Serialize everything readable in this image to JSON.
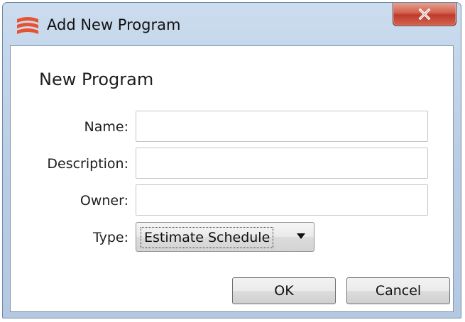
{
  "window": {
    "title": "Add New Program",
    "icon": "app-logo-icon",
    "close_label": "x"
  },
  "dialog": {
    "heading": "New Program",
    "fields": {
      "name": {
        "label": "Name:",
        "value": ""
      },
      "description": {
        "label": "Description:",
        "value": ""
      },
      "owner": {
        "label": "Owner:",
        "value": ""
      }
    },
    "type": {
      "label": "Type:",
      "selected": "Estimate Schedule"
    },
    "buttons": {
      "ok": "OK",
      "cancel": "Cancel"
    }
  },
  "colors": {
    "title_bar": "#b9cde4",
    "close_button": "#c0392b",
    "logo": "#e8532f"
  }
}
